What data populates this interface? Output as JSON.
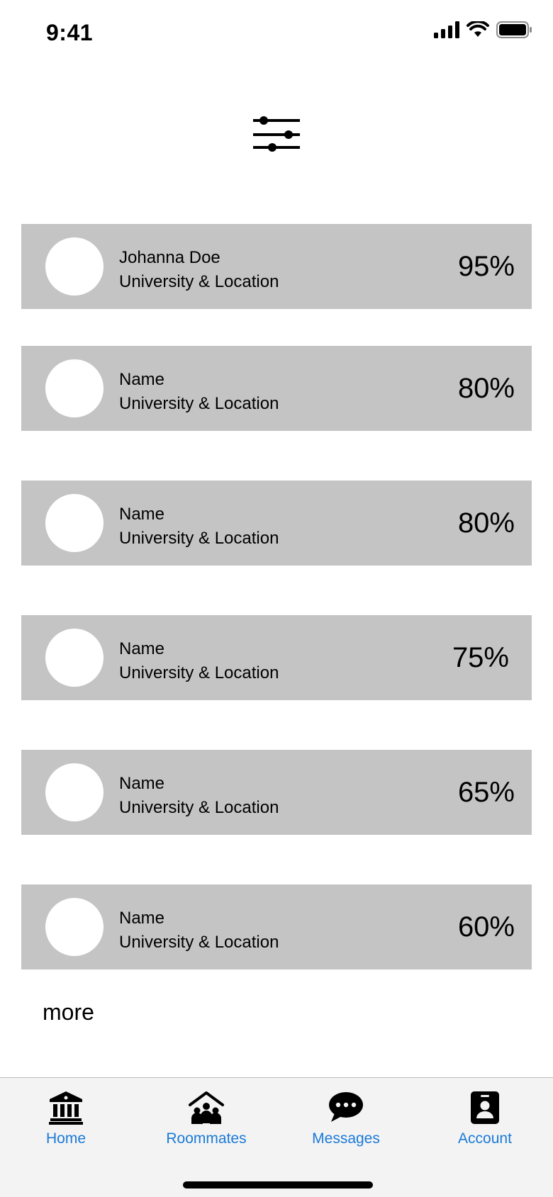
{
  "status_bar": {
    "time": "9:41"
  },
  "filter_icon": "sliders-icon",
  "matches": [
    {
      "name": "Johanna Doe",
      "subtitle": "University & Location",
      "percent": "95%"
    },
    {
      "name": "Name",
      "subtitle": "University & Location",
      "percent": "80%"
    },
    {
      "name": "Name",
      "subtitle": "University & Location",
      "percent": "80%"
    },
    {
      "name": "Name",
      "subtitle": "University & Location",
      "percent": "75%"
    },
    {
      "name": "Name",
      "subtitle": "University & Location",
      "percent": "65%"
    },
    {
      "name": "Name",
      "subtitle": "University & Location",
      "percent": "60%"
    }
  ],
  "more_label": "more",
  "tabs": [
    {
      "label": "Home",
      "icon": "bank-icon"
    },
    {
      "label": "Roommates",
      "icon": "people-house-icon"
    },
    {
      "label": "Messages",
      "icon": "chat-bubble-icon"
    },
    {
      "label": "Account",
      "icon": "id-badge-icon"
    }
  ],
  "colors": {
    "card": "#c4c4c4",
    "tab_accent": "#1a7ad8",
    "tab_bar": "#f3f3f3"
  }
}
